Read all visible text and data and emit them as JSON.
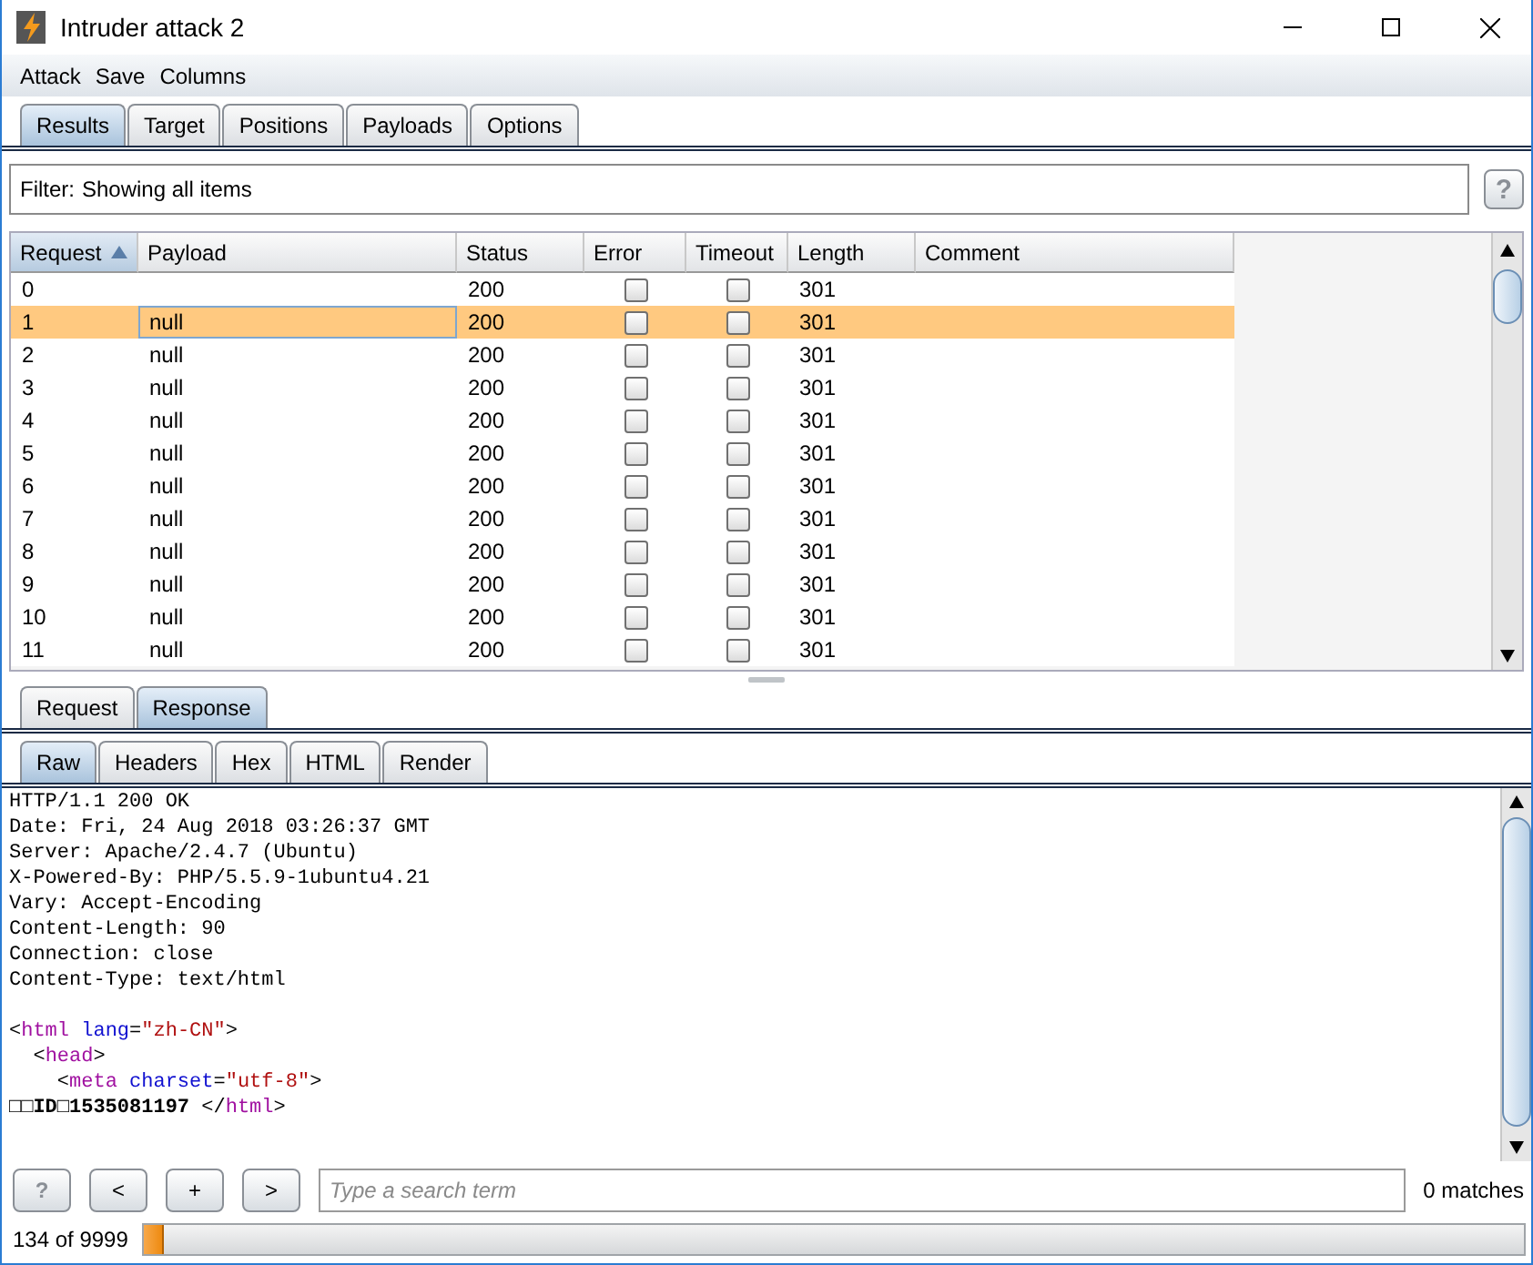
{
  "window": {
    "title": "Intruder attack 2"
  },
  "menu": [
    "Attack",
    "Save",
    "Columns"
  ],
  "tabs": [
    {
      "label": "Results",
      "selected": true
    },
    {
      "label": "Target",
      "selected": false
    },
    {
      "label": "Positions",
      "selected": false
    },
    {
      "label": "Payloads",
      "selected": false
    },
    {
      "label": "Options",
      "selected": false
    }
  ],
  "filter": {
    "label": "Filter:",
    "value": "Showing all items",
    "help": "?"
  },
  "table": {
    "columns": [
      {
        "label": "Request",
        "sorted": true
      },
      {
        "label": "Payload",
        "sorted": false
      },
      {
        "label": "Status",
        "sorted": false
      },
      {
        "label": "Error",
        "sorted": false
      },
      {
        "label": "Timeout",
        "sorted": false
      },
      {
        "label": "Length",
        "sorted": false
      },
      {
        "label": "Comment",
        "sorted": false
      }
    ],
    "rows": [
      {
        "request": "0",
        "status": "200",
        "error": false,
        "timeout": false,
        "length": "301",
        "selected": false
      },
      {
        "request": "1",
        "payload": "null",
        "status": "200",
        "error": false,
        "timeout": false,
        "length": "301",
        "selected": true
      },
      {
        "request": "2",
        "payload": "null",
        "status": "200",
        "error": false,
        "timeout": false,
        "length": "301",
        "selected": false
      },
      {
        "request": "3",
        "payload": "null",
        "status": "200",
        "error": false,
        "timeout": false,
        "length": "301",
        "selected": false
      },
      {
        "request": "4",
        "payload": "null",
        "status": "200",
        "error": false,
        "timeout": false,
        "length": "301",
        "selected": false
      },
      {
        "request": "5",
        "payload": "null",
        "status": "200",
        "error": false,
        "timeout": false,
        "length": "301",
        "selected": false
      },
      {
        "request": "6",
        "payload": "null",
        "status": "200",
        "error": false,
        "timeout": false,
        "length": "301",
        "selected": false
      },
      {
        "request": "7",
        "payload": "null",
        "status": "200",
        "error": false,
        "timeout": false,
        "length": "301",
        "selected": false
      },
      {
        "request": "8",
        "payload": "null",
        "status": "200",
        "error": false,
        "timeout": false,
        "length": "301",
        "selected": false
      },
      {
        "request": "9",
        "payload": "null",
        "status": "200",
        "error": false,
        "timeout": false,
        "length": "301",
        "selected": false
      },
      {
        "request": "10",
        "payload": "null",
        "status": "200",
        "error": false,
        "timeout": false,
        "length": "301",
        "selected": false
      },
      {
        "request": "11",
        "payload": "null",
        "status": "200",
        "error": false,
        "timeout": false,
        "length": "301",
        "selected": false
      }
    ]
  },
  "message_tabs": [
    {
      "label": "Request",
      "selected": false
    },
    {
      "label": "Response",
      "selected": true
    }
  ],
  "view_tabs": [
    {
      "label": "Raw",
      "selected": true
    },
    {
      "label": "Headers",
      "selected": false
    },
    {
      "label": "Hex",
      "selected": false
    },
    {
      "label": "HTML",
      "selected": false
    },
    {
      "label": "Render",
      "selected": false
    }
  ],
  "response": {
    "headers": [
      "HTTP/1.1 200 OK",
      "Date: Fri, 24 Aug 2018 03:26:37 GMT",
      "Server: Apache/2.4.7 (Ubuntu)",
      "X-Powered-By: PHP/5.5.9-1ubuntu4.21",
      "Vary: Accept-Encoding",
      "Content-Length: 90",
      "Connection: close",
      "Content-Type: text/html"
    ],
    "lines": [
      [
        {
          "kind": "plain",
          "text": "<"
        },
        {
          "kind": "tag",
          "text": "html"
        },
        {
          "kind": "attr",
          "text": " lang"
        },
        {
          "kind": "plain",
          "text": "="
        },
        {
          "kind": "value",
          "text": "\"zh-CN\""
        },
        {
          "kind": "plain",
          "text": ">"
        }
      ],
      [
        {
          "kind": "plain",
          "text": "  <"
        },
        {
          "kind": "tag",
          "text": "head"
        },
        {
          "kind": "plain",
          "text": ">"
        }
      ],
      [
        {
          "kind": "plain",
          "text": "    <"
        },
        {
          "kind": "tag",
          "text": "meta"
        },
        {
          "kind": "attr",
          "text": " charset"
        },
        {
          "kind": "plain",
          "text": "="
        },
        {
          "kind": "value",
          "text": "\"utf-8\""
        },
        {
          "kind": "plain",
          "text": ">"
        }
      ],
      [
        {
          "kind": "bold",
          "text": "□□ID□1535081197"
        },
        {
          "kind": "plain",
          "text": " </"
        },
        {
          "kind": "tag",
          "text": "html"
        },
        {
          "kind": "plain",
          "text": ">"
        }
      ]
    ]
  },
  "search": {
    "buttons": [
      "?",
      "<",
      "+",
      ">"
    ],
    "placeholder": "Type a search term",
    "matches": "0 matches"
  },
  "progress": {
    "label": "134 of 9999",
    "level": 0.0134
  }
}
